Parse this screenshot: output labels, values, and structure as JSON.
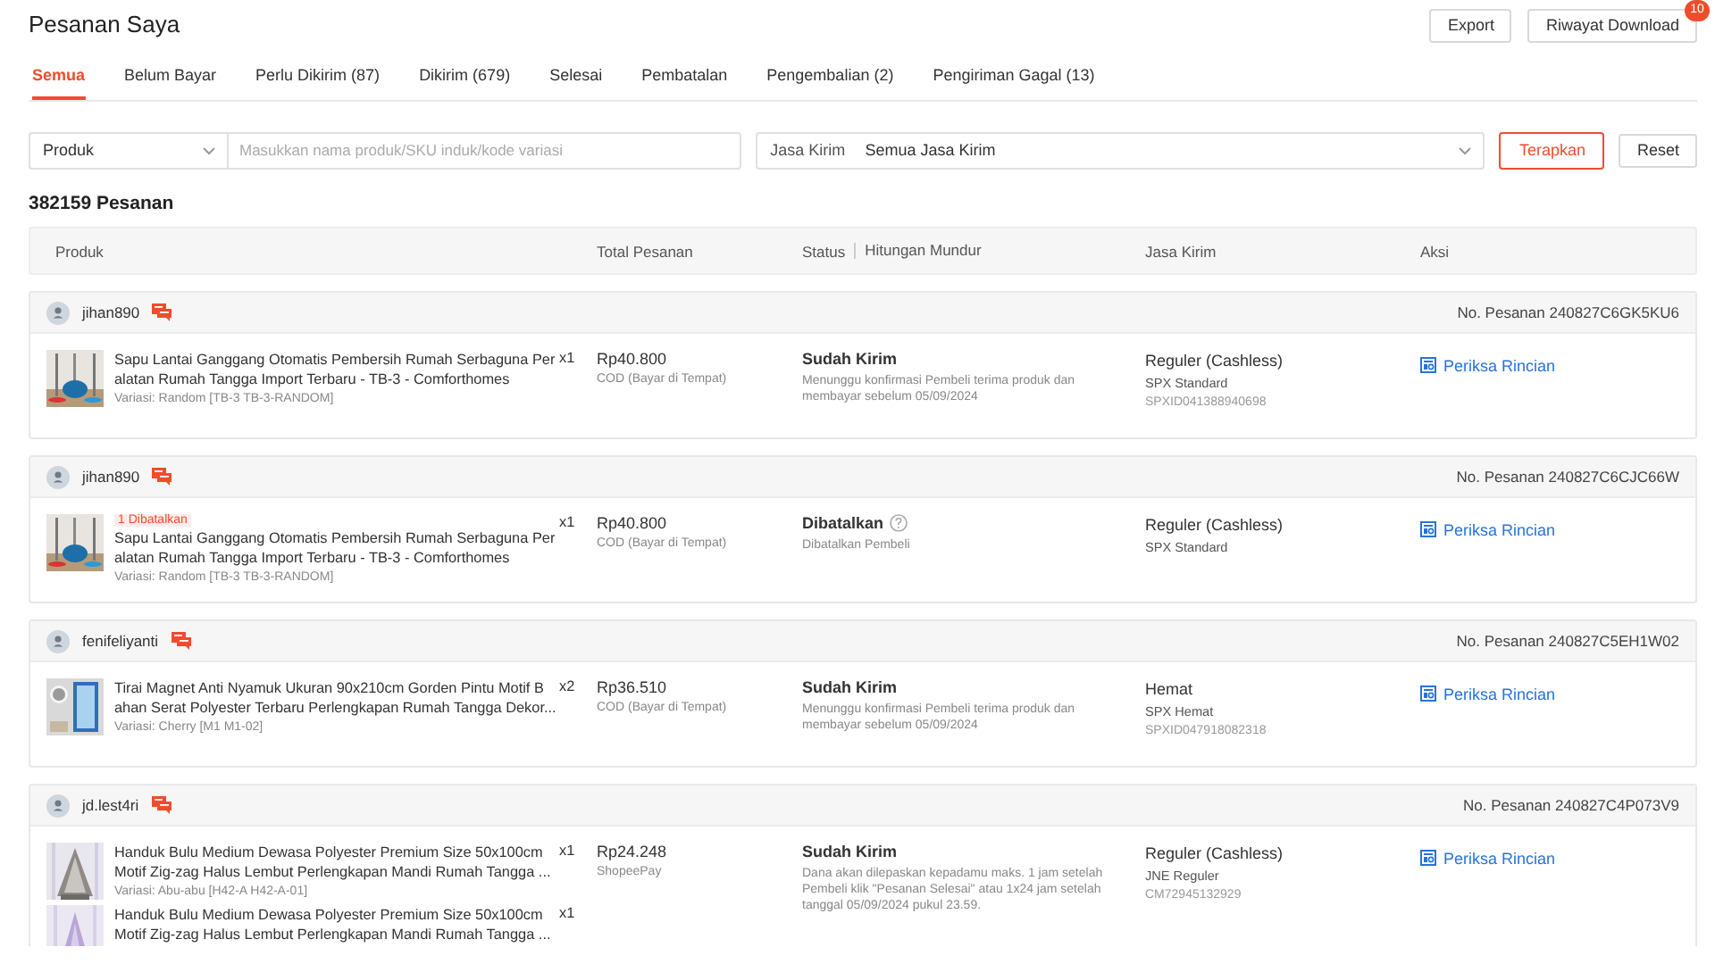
{
  "page_title": "Pesanan Saya",
  "header_buttons": [
    {
      "label": "Export"
    },
    {
      "label": "Riwayat Download",
      "badge": "10"
    }
  ],
  "tabs": [
    {
      "label": "Semua",
      "selected": true
    },
    {
      "label": "Belum Bayar",
      "selected": false
    },
    {
      "label": "Perlu Dikirim (87)",
      "selected": false
    },
    {
      "label": "Dikirim (679)",
      "selected": false
    },
    {
      "label": "Selesai",
      "selected": false
    },
    {
      "label": "Pembatalan",
      "selected": false
    },
    {
      "label": "Pengembalian (2)",
      "selected": false
    },
    {
      "label": "Pengiriman Gagal (13)",
      "selected": false
    }
  ],
  "filters": {
    "search_type": "Produk",
    "search_placeholder": "Masukkan nama produk/SKU induk/kode variasi",
    "courier_label": "Jasa Kirim",
    "courier_value": "Semua Jasa Kirim",
    "apply": "Terapkan",
    "reset": "Reset"
  },
  "order_count": "382159 Pesanan",
  "table": {
    "columns": [
      "Produk",
      "Total Pesanan",
      "Status",
      "Hitungan Mundur",
      "Jasa Kirim",
      "Aksi"
    ],
    "orders": [
      {
        "buyer": "jihan890",
        "order_no": "No. Pesanan 240827C6GK5KU6",
        "products": [
          {
            "kind": "picture",
            "lines": [
              "Sapu Lantai Ganggang Otomatis Pembersih Rumah Serbaguna Per",
              "alatan Rumah Tangga Import Terbaru - TB-3 - Comforthomes"
            ],
            "variation": "Variasi: Random [TB-3 TB-3-RANDOM]",
            "qty": "x1"
          }
        ],
        "total": "Rp40.800",
        "payment": "COD (Bayar di Tempat)",
        "status": {
          "title": "Sudah Kirim",
          "info_icon": false,
          "note": "Menunggu konfirmasi Pembeli terima produk dan\nmembayar sebelum 05/09/2024"
        },
        "courier": {
          "name": "Reguler (Cashless)",
          "service": "SPX Standard",
          "tracking": "SPXID041388940698"
        },
        "action": "Periksa Rincian"
      },
      {
        "buyer": "jihan890",
        "order_no": "No. Pesanan 240827C6CJC66W",
        "products": [
          {
            "kind": "picture",
            "badge": "1 Dibatalkan",
            "lines": [
              "Sapu Lantai Ganggang Otomatis Pembersih Rumah Serbaguna Per",
              "alatan Rumah Tangga Import Terbaru - TB-3 - Comforthomes"
            ],
            "variation": "Variasi: Random [TB-3 TB-3-RANDOM]",
            "qty": "x1"
          }
        ],
        "total": "Rp40.800",
        "payment": "COD (Bayar di Tempat)",
        "status": {
          "title": "Dibatalkan",
          "info_icon": true,
          "note": "Dibatalkan Pembeli"
        },
        "courier": {
          "name": "Reguler (Cashless)",
          "service": "SPX Standard"
        },
        "action": "Periksa Rincian"
      },
      {
        "buyer": "fenifeliyanti",
        "order_no": "No. Pesanan 240827C5EH1W02",
        "products": [
          {
            "kind": "picture",
            "lines": [
              "Tirai Magnet Anti Nyamuk Ukuran 90x210cm Gorden Pintu Motif B",
              "ahan Serat Polyester Terbaru Perlengkapan Rumah Tangga Dekor..."
            ],
            "variation": "Variasi: Cherry [M1 M1-02]",
            "qty": "x2"
          }
        ],
        "total": "Rp36.510",
        "payment": "COD (Bayar di Tempat)",
        "status": {
          "title": "Sudah Kirim",
          "info_icon": false,
          "note": "Menunggu konfirmasi Pembeli terima produk dan\nmembayar sebelum 05/09/2024"
        },
        "courier": {
          "name": "Hemat",
          "service": "SPX Hemat",
          "tracking": "SPXID047918082318"
        },
        "action": "Periksa Rincian"
      },
      {
        "buyer": "jd.lest4ri",
        "order_no": "No. Pesanan 240827C4P073V9",
        "products": [
          {
            "kind": "picture",
            "lines": [
              "Handuk Bulu Medium Dewasa Polyester Premium Size 50x100cm",
              "Motif Zig-zag Halus Lembut Perlengkapan Mandi Rumah Tangga ..."
            ],
            "variation": "Variasi: Abu-abu [H42-A H42-A-01]",
            "qty": "x1"
          },
          {
            "kind": "picture",
            "lines": [
              "Handuk Bulu Medium Dewasa Polyester Premium Size 50x100cm",
              "Motif Zig-zag Halus Lembut Perlengkapan Mandi Rumah Tangga ..."
            ],
            "qty": "x1"
          }
        ],
        "total": "Rp24.248",
        "payment": "ShopeePay",
        "status": {
          "title": "Sudah Kirim",
          "info_icon": false,
          "note": "Dana akan dilepaskan kepadamu maks. 1 jam setelah\nPembeli klik \"Pesanan Selesai\" atau 1x24 jam setelah\ntanggal 05/09/2024 pukul 23.59."
        },
        "courier": {
          "name": "Reguler (Cashless)",
          "service": "JNE Reguler",
          "tracking": "CM72945132929"
        },
        "action": "Periksa Rincian"
      }
    ]
  }
}
